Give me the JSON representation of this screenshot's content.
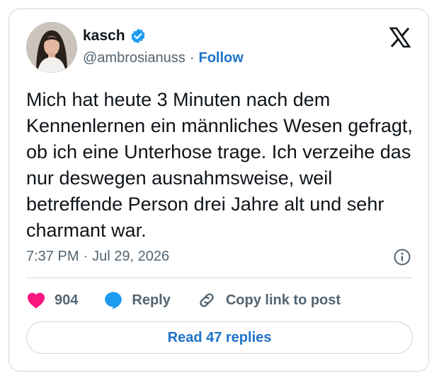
{
  "author": {
    "display_name": "kasch",
    "handle": "@ambrosianuss",
    "verified": true,
    "follow_label": "Follow",
    "separator": "·"
  },
  "tweet": {
    "text": "Mich hat heute 3 Minuten nach dem Kennenlernen ein männliches Wesen gefragt, ob ich eine Unterhose trage. Ich verzeihe das nur deswegen ausnahmsweise, weil betreffende Person drei Jahre alt und sehr charmant war.",
    "time": "7:37 PM",
    "date": "Jul 29, 2026",
    "separator": "·"
  },
  "actions": {
    "likes_count": "904",
    "reply_label": "Reply",
    "copy_link_label": "Copy link to post"
  },
  "replies_button": {
    "label": "Read 47 replies"
  },
  "icons": {
    "logo": "x-logo-icon",
    "verified": "verified-badge-icon",
    "info": "info-icon",
    "like": "heart-icon",
    "reply": "speech-bubble-icon",
    "copy_link": "link-icon"
  },
  "colors": {
    "accent": "#1d73c9",
    "like": "#f91880",
    "muted": "#536471",
    "text": "#0f1419",
    "border": "#cfd9de",
    "verified": "#1d9bf0"
  }
}
